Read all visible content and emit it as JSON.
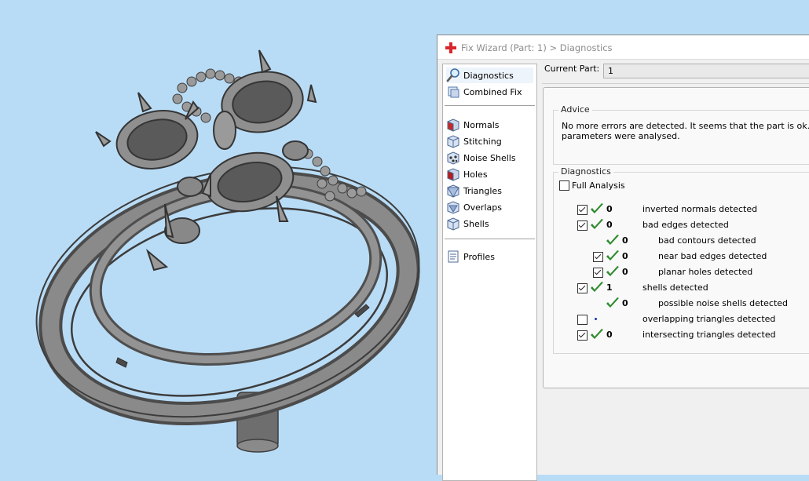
{
  "window": {
    "title": "Fix Wizard (Part: 1) > Diagnostics"
  },
  "nav": {
    "items": [
      {
        "label": "Diagnostics",
        "icon": "magnifier-icon",
        "selected": true
      },
      {
        "label": "Combined Fix",
        "icon": "cubes-icon"
      },
      {
        "label": "Normals",
        "icon": "red-cube-icon"
      },
      {
        "label": "Stitching",
        "icon": "cube-icon"
      },
      {
        "label": "Noise Shells",
        "icon": "dotted-cube-icon"
      },
      {
        "label": "Holes",
        "icon": "holes-cube-icon"
      },
      {
        "label": "Triangles",
        "icon": "triangles-cube-icon"
      },
      {
        "label": "Overlaps",
        "icon": "overlaps-cube-icon"
      },
      {
        "label": "Shells",
        "icon": "cube-icon"
      },
      {
        "label": "Profiles",
        "icon": "document-icon"
      }
    ]
  },
  "current_part": {
    "label": "Current Part:",
    "value": "1"
  },
  "advice": {
    "title": "Advice",
    "line1": "No more errors are detected. It seems that the part is ok. Note",
    "line2": "parameters were analysed."
  },
  "diagnostics": {
    "title": "Diagnostics",
    "full_analysis_label": "Full Analysis",
    "full_analysis_checked": false,
    "rows": [
      {
        "checked": true,
        "status": "ok",
        "count": "0",
        "label": "inverted normals detected",
        "indent": 0
      },
      {
        "checked": true,
        "status": "ok",
        "count": "0",
        "label": "bad edges detected",
        "indent": 0
      },
      {
        "checked": null,
        "status": "ok",
        "count": "0",
        "label": "bad contours detected",
        "indent": 1
      },
      {
        "checked": true,
        "status": "ok",
        "count": "0",
        "label": "near bad edges detected",
        "indent": 1
      },
      {
        "checked": true,
        "status": "ok",
        "count": "0",
        "label": "planar holes detected",
        "indent": 1
      },
      {
        "checked": true,
        "status": "ok",
        "count": "1",
        "label": "shells detected",
        "indent": 0
      },
      {
        "checked": null,
        "status": "ok",
        "count": "0",
        "label": "possible noise shells detected",
        "indent": 1
      },
      {
        "checked": false,
        "status": "unknown",
        "count": "",
        "label": "overlapping triangles detected",
        "indent": 0
      },
      {
        "checked": true,
        "status": "ok",
        "count": "0",
        "label": "intersecting triangles detected",
        "indent": 0
      }
    ]
  },
  "colors": {
    "background": "#b9dcf6",
    "ok_green": "#2e8b2e",
    "model_gray": "#7a7a7a"
  }
}
